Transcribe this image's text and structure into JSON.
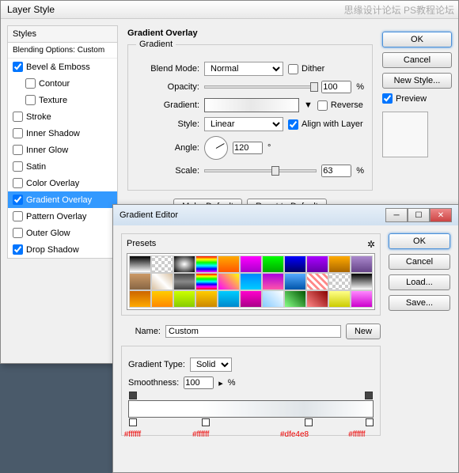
{
  "watermark": "思缘设计论坛  PS教程论坛",
  "layerStyle": {
    "title": "Layer Style",
    "stylesHeader": "Styles",
    "blendingOptions": "Blending Options: Custom",
    "items": [
      {
        "label": "Bevel & Emboss",
        "checked": true
      },
      {
        "label": "Contour",
        "checked": false,
        "indent": true
      },
      {
        "label": "Texture",
        "checked": false,
        "indent": true
      },
      {
        "label": "Stroke",
        "checked": false
      },
      {
        "label": "Inner Shadow",
        "checked": false
      },
      {
        "label": "Inner Glow",
        "checked": false
      },
      {
        "label": "Satin",
        "checked": false
      },
      {
        "label": "Color Overlay",
        "checked": false
      },
      {
        "label": "Gradient Overlay",
        "checked": true,
        "selected": true
      },
      {
        "label": "Pattern Overlay",
        "checked": false
      },
      {
        "label": "Outer Glow",
        "checked": false
      },
      {
        "label": "Drop Shadow",
        "checked": true
      }
    ],
    "sectionTitle": "Gradient Overlay",
    "groupTitle": "Gradient",
    "blendModeLabel": "Blend Mode:",
    "blendModeValue": "Normal",
    "ditherLabel": "Dither",
    "opacityLabel": "Opacity:",
    "opacityValue": "100",
    "pct": "%",
    "gradientLabel": "Gradient:",
    "reverseLabel": "Reverse",
    "styleLabel": "Style:",
    "styleValue": "Linear",
    "alignLabel": "Align with Layer",
    "angleLabel": "Angle:",
    "angleValue": "120",
    "deg": "°",
    "scaleLabel": "Scale:",
    "scaleValue": "63",
    "makeDefault": "Make Default",
    "resetDefault": "Reset to Default",
    "ok": "OK",
    "cancel": "Cancel",
    "newStyle": "New Style...",
    "previewLabel": "Preview"
  },
  "gradientEditor": {
    "title": "Gradient Editor",
    "presetsLabel": "Presets",
    "ok": "OK",
    "cancel": "Cancel",
    "load": "Load...",
    "save": "Save...",
    "nameLabel": "Name:",
    "nameValue": "Custom",
    "new": "New",
    "gradTypeLabel": "Gradient Type:",
    "gradTypeValue": "Solid",
    "smoothLabel": "Smoothness:",
    "smoothValue": "100",
    "pct": "%",
    "stops": [
      "#ffffff",
      "#ffffff",
      "#dfe4e8",
      "#ffffff"
    ],
    "swatches": [
      "linear-gradient(#000,#fff)",
      "repeating-conic-gradient(#ccc 0 25%,#fff 0 50%) 0/8px 8px",
      "radial-gradient(#fff,#000)",
      "linear-gradient(#f00,#ff0,#0f0,#0ff,#00f,#f0f)",
      "linear-gradient(#fa0,#f50)",
      "linear-gradient(#f0f,#a0c)",
      "linear-gradient(#0f0,#0a0)",
      "linear-gradient(#00f,#006)",
      "linear-gradient(#a0f,#60a)",
      "linear-gradient(#fa0,#a60)",
      "linear-gradient(#a8c,#648)",
      "linear-gradient(#c96,#864)",
      "linear-gradient(45deg,#d8c0a0,#fff,#d8c0a0)",
      "linear-gradient(#444,#888,#444)",
      "linear-gradient(#f00,#ff0,#0f0,#0ff,#00f,#f0f,#f00)",
      "linear-gradient(45deg,#f0f,#ff0)",
      "linear-gradient(#08f,#0cf)",
      "linear-gradient(#a0d,#f5a)",
      "linear-gradient(#5af,#05a)",
      "repeating-linear-gradient(45deg,#fff,#fff 3px,#f88 3px,#f88 6px)",
      "repeating-conic-gradient(#ccc 0 25%,#fff 0 50%) 0/8px 8px",
      "linear-gradient(#000,#fff)",
      "linear-gradient(#c60,#fa0)",
      "linear-gradient(#fc0,#f80)",
      "linear-gradient(#cf0,#8c0)",
      "linear-gradient(#fc0,#c80)",
      "linear-gradient(#0cf,#08c)",
      "linear-gradient(#f0c,#a08)",
      "linear-gradient(45deg,#8cf,#fff)",
      "linear-gradient(45deg,#8f8,#050)",
      "linear-gradient(45deg,#f88,#800)",
      "linear-gradient(#ff8,#cc0)",
      "linear-gradient(#f8f,#c0c)"
    ]
  }
}
